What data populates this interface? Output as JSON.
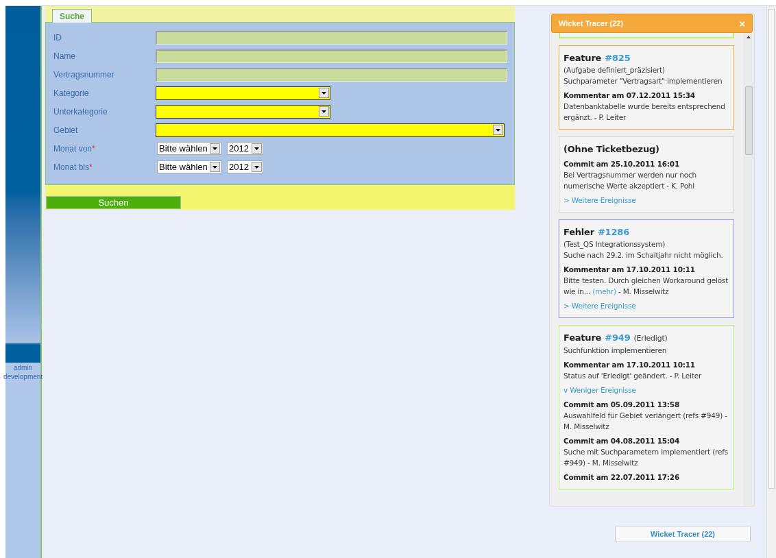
{
  "sidebar": {
    "user_lines": [
      "admin",
      "development"
    ]
  },
  "search": {
    "tab": "Suche",
    "button": "Suchen",
    "fields": [
      {
        "kind": "text",
        "label": "ID"
      },
      {
        "kind": "text",
        "label": "Name"
      },
      {
        "kind": "text",
        "label": "Vertragsnummer"
      },
      {
        "kind": "select",
        "label": "Kategorie"
      },
      {
        "kind": "select",
        "label": "Unterkategorie"
      },
      {
        "kind": "wide_select",
        "label": "Gebiet"
      },
      {
        "kind": "month",
        "label": "Monat von",
        "required_mark": "*",
        "month": "Bitte wählen",
        "year": "2012"
      },
      {
        "kind": "month",
        "label": "Monat bis",
        "required_mark": "*",
        "month": "Bitte wählen",
        "year": "2012"
      }
    ]
  },
  "tracer": {
    "title": "Wicket Tracer (22)",
    "close": "×",
    "footer_button": "Wicket Tracer (22)",
    "cards": [
      {
        "color": "#b9f06a"
      },
      {
        "color": "#f5a93c",
        "type": "Feature",
        "ref": "#825",
        "items": [
          {
            "kind": "text",
            "text": "(Aufgabe definiert_präzisiert)"
          },
          {
            "kind": "text",
            "text": "Suchparameter \"Vertragsart\" implementieren"
          },
          {
            "kind": "event",
            "heading": "Kommentar am 07.12.2011 15:34",
            "text": "Datenbanktabelle wurde bereits entsprechend ergänzt. - P. Leiter"
          }
        ]
      },
      {
        "color": "#cfcfcf",
        "type": "(Ohne Ticketbezug)",
        "items": [
          {
            "kind": "event",
            "heading": "Commit am 25.10.2011 16:01",
            "text": "Bei Vertragsnummer werden nur noch numerische Werte akzeptiert - K. Pohl"
          },
          {
            "kind": "toggle",
            "text": "> Weitere Ereignisse"
          }
        ]
      },
      {
        "color": "#8f99f2",
        "type": "Fehler",
        "ref": "#1286",
        "items": [
          {
            "kind": "text",
            "text": "(Test_QS Integrationssystem)"
          },
          {
            "kind": "text",
            "text": "Suche nach 29.2. im Schaltjahr nicht möglich."
          },
          {
            "kind": "event",
            "heading": "Kommentar am 17.10.2011 10:11",
            "text": "Bitte testen. Durch gleichen Workaround gelöst wie in...",
            "more": "(mehr)",
            "author": "- M. Misselwitz"
          },
          {
            "kind": "toggle",
            "text": "> Weitere Ereignisse"
          }
        ]
      },
      {
        "color": "#b9f06a",
        "type": "Feature",
        "ref": "#949",
        "status": "(Erledigt)",
        "items": [
          {
            "kind": "text",
            "text": "Suchfunktion implementieren"
          },
          {
            "kind": "event",
            "heading": "Kommentar am 17.10.2011 10:11",
            "text": "Status auf 'Erledigt' geändert. - P. Leiter"
          },
          {
            "kind": "toggle",
            "text": "v Weniger Ereignisse"
          },
          {
            "kind": "event",
            "heading": "Commit am 05.09.2011 13:58",
            "text": "Auswahlfeld für Gebiet verlängert (refs #949) - M. Misselwitz"
          },
          {
            "kind": "event",
            "heading": "Commit am 04.08.2011 15:04",
            "text": "Suche mit Suchparametern implementiert (refs #949) - M. Misselwitz"
          },
          {
            "kind": "event",
            "heading": "Commit am 22.07.2011 17:26"
          }
        ]
      }
    ]
  }
}
